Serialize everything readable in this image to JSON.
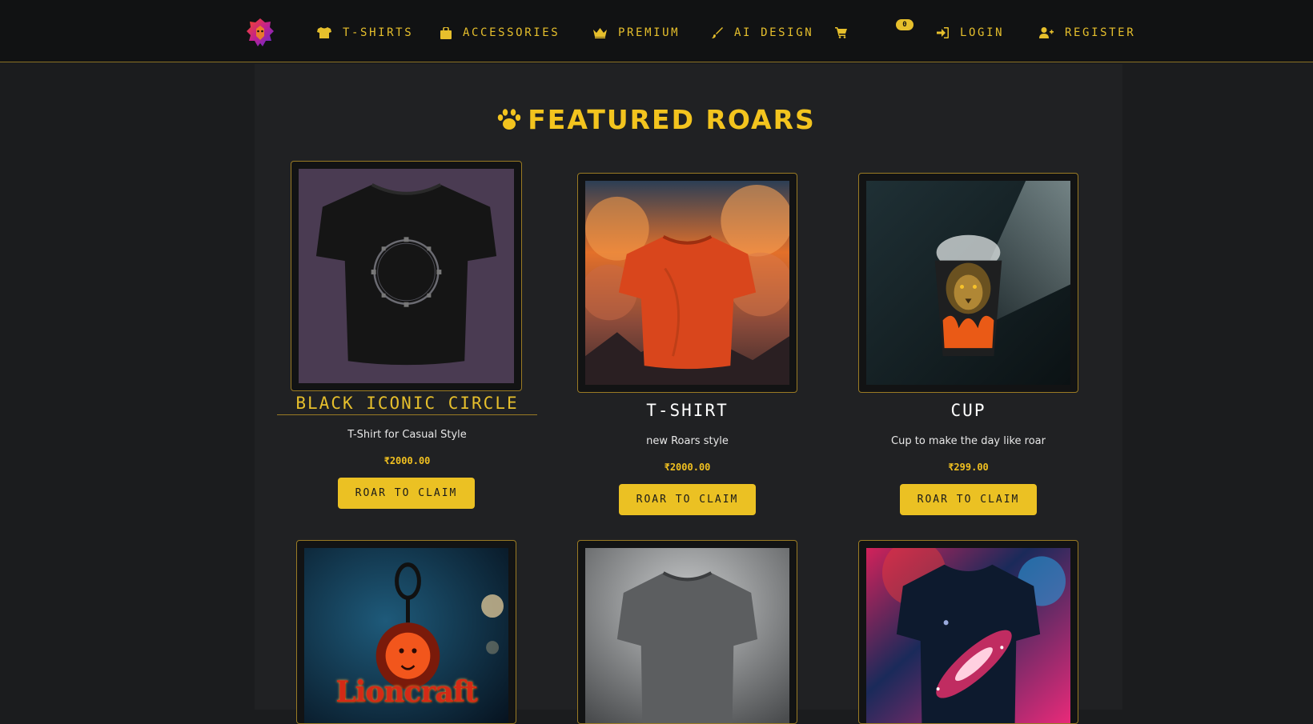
{
  "colors": {
    "accent": "#e6bf2c",
    "nav_bg": "#111213",
    "page_bg": "#1b1c1e",
    "content_bg": "#202123",
    "button_bg": "#ebc123"
  },
  "nav": {
    "logo_icon": "lion-logo-icon",
    "items": [
      {
        "label": "T-SHIRTS",
        "icon": "tshirt-icon"
      },
      {
        "label": "ACCESSORIES",
        "icon": "bag-icon"
      },
      {
        "label": "PREMIUM",
        "icon": "crown-icon"
      },
      {
        "label": "AI DESIGN",
        "icon": "brush-icon"
      },
      {
        "label": "",
        "icon": "cart-icon"
      },
      {
        "label": "LOGIN",
        "icon": "sign-in-icon"
      },
      {
        "label": "REGISTER",
        "icon": "user-plus-icon"
      }
    ],
    "cart_count": "0"
  },
  "featured": {
    "title": "FEATURED ROARS",
    "icon": "paw-icon"
  },
  "products": [
    {
      "name": "BLACK ICONIC CIRCLE",
      "description": "T-Shirt for Casual Style",
      "price": "₹2000.00",
      "button": "ROAR TO CLAIM"
    },
    {
      "name": "T-SHIRT",
      "description": "new Roars style",
      "price": "₹2000.00",
      "button": "ROAR TO CLAIM"
    },
    {
      "name": "CUP",
      "description": "Cup to make the day like roar",
      "price": "₹299.00",
      "button": "ROAR TO CLAIM"
    },
    {
      "name": "",
      "description": "",
      "price": "",
      "button": "",
      "image_text": "Lioncraft"
    },
    {
      "name": "",
      "description": "",
      "price": "",
      "button": ""
    },
    {
      "name": "",
      "description": "",
      "price": "",
      "button": ""
    }
  ]
}
